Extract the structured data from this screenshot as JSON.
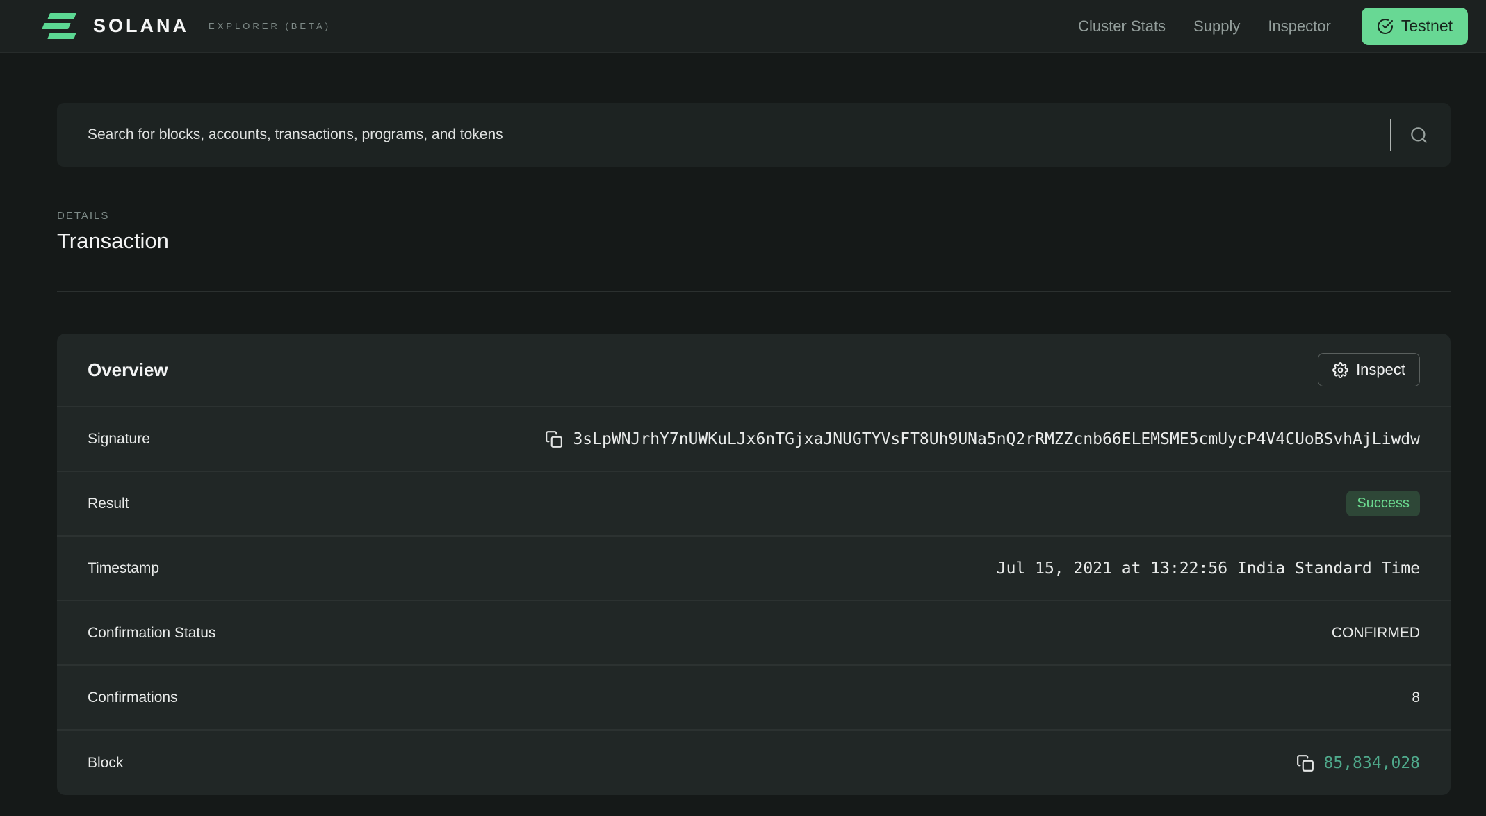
{
  "navbar": {
    "brand": "SOLANA",
    "brand_suffix": "EXPLORER (BETA)",
    "links": [
      {
        "label": "Cluster Stats"
      },
      {
        "label": "Supply"
      },
      {
        "label": "Inspector"
      }
    ],
    "cluster_button": "Testnet"
  },
  "search": {
    "placeholder": "Search for blocks, accounts, transactions, programs, and tokens"
  },
  "page": {
    "eyebrow": "DETAILS",
    "title": "Transaction"
  },
  "overview": {
    "title": "Overview",
    "inspect_label": "Inspect",
    "rows": [
      {
        "label": "Signature",
        "value": "3sLpWNJrhY7nUWKuLJx6nTGjxaJNUGTYVsFT8Uh9UNa5nQ2rRMZZcnb66ELEMSME5cmUycP4V4CUoBSvhAjLiwdw"
      },
      {
        "label": "Result",
        "value": "Success"
      },
      {
        "label": "Timestamp",
        "value": "Jul 15, 2021 at 13:22:56 India Standard Time"
      },
      {
        "label": "Confirmation Status",
        "value": "CONFIRMED"
      },
      {
        "label": "Confirmations",
        "value": "8"
      },
      {
        "label": "Block",
        "value": "85,834,028"
      }
    ]
  },
  "colors": {
    "accent_green": "#5cd893",
    "success_text": "#6bd98f",
    "success_bg": "#2e4737",
    "block_link_green": "#4fa98b",
    "card_bg": "#212726",
    "page_bg": "#151918"
  }
}
